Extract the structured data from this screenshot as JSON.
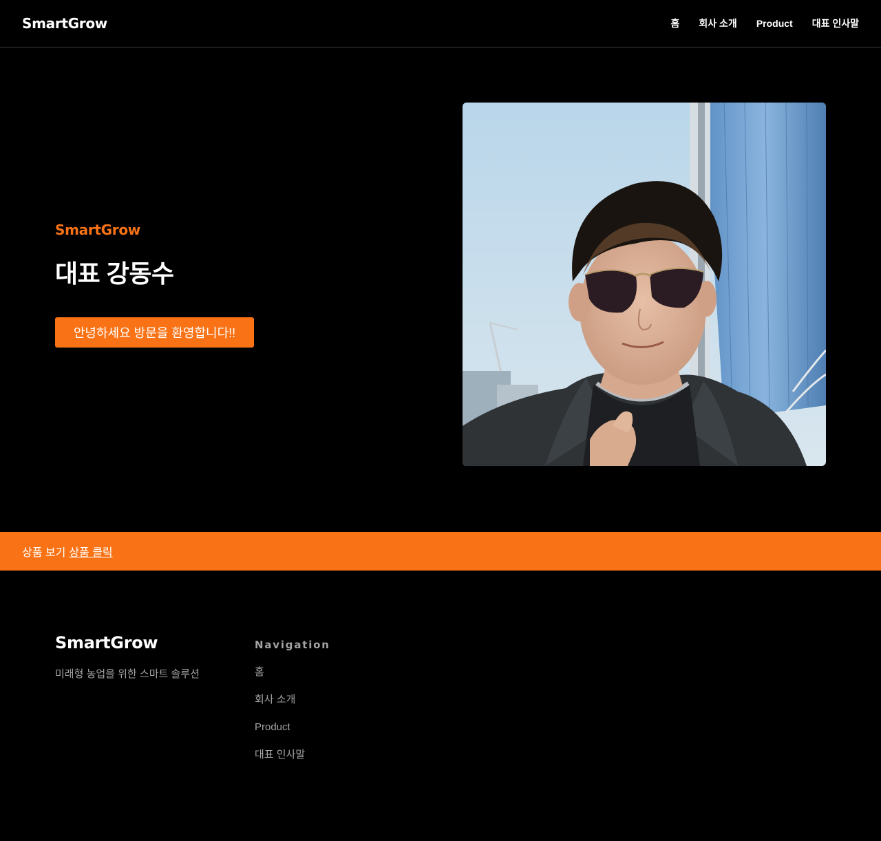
{
  "header": {
    "logo": "SmartGrow",
    "nav": [
      {
        "label": "홈"
      },
      {
        "label": "회사 소개"
      },
      {
        "label": "Product"
      },
      {
        "label": "대표 인사말"
      }
    ]
  },
  "hero": {
    "eyebrow": "SmartGrow",
    "title": "대표 강동수",
    "button_label": "안녕하세요 방문을 환영합니다!!"
  },
  "banner": {
    "text": "상품 보기",
    "link_label": "상품 클릭"
  },
  "footer": {
    "logo": "SmartGrow",
    "tagline": "미래형 농업을 위한 스마트 솔루션",
    "nav_title": "Navigation",
    "nav": [
      {
        "label": "홈"
      },
      {
        "label": "회사 소개"
      },
      {
        "label": "Product"
      },
      {
        "label": "대표 인사말"
      }
    ]
  },
  "colors": {
    "accent": "#f97316",
    "background": "#000000",
    "muted_text": "#a3a3a3"
  }
}
